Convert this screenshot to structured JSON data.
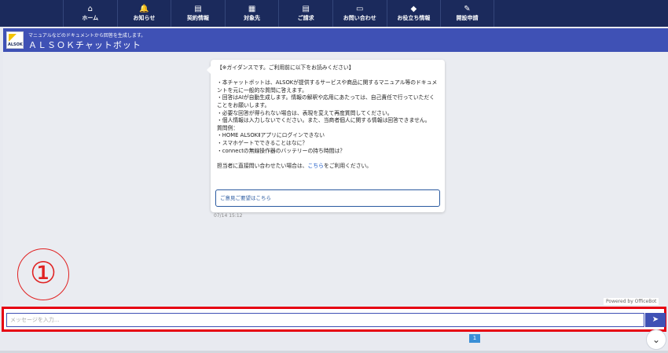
{
  "nav": {
    "items": [
      {
        "label": "ホーム",
        "icon": "⌂"
      },
      {
        "label": "お知らせ",
        "icon": "🔔"
      },
      {
        "label": "契約情報",
        "icon": "▤"
      },
      {
        "label": "対象先",
        "icon": "▦"
      },
      {
        "label": "ご請求",
        "icon": "▤"
      },
      {
        "label": "お問い合わせ",
        "icon": "▭"
      },
      {
        "label": "お役立ち情報",
        "icon": "◆"
      },
      {
        "label": "開設申請",
        "icon": "✎"
      }
    ]
  },
  "header": {
    "logo_text": "ALSOK",
    "subtitle": "マニュアルなどのドキュメントから回答を生成します。",
    "title": "ＡＬＳＯＫチャットボット"
  },
  "message": {
    "lines": [
      "【※ガイダンスです。ご利用前に以下をお読みください】",
      "",
      "・本チャットボットは、ALSOKが提供するサービスや商品に関するマニュアル等のドキュメントを元に一般的な質問に答えます。",
      "・回答はAIが自動生成します。情報の解釈や応用にあたっては、自己責任で行っていただくことをお願いします。",
      "・必要な回答が得られない場合は、表現を変えて再度質問してください。",
      "・個人情報は入力しないでください。また、当商者個人に関する情報は回答できません。",
      "質問例：",
      "・HOME ALSOKⅡアプリにログインできない",
      "・スマホゲートでできることはなに？",
      "・connectの無線操作器のバッテリーの持ち時間は？",
      ""
    ],
    "contact_prefix": "担当者に直接問い合わせたい場合は、",
    "contact_link": "こちら",
    "contact_suffix": "をご利用ください。",
    "button_label": "ご意見ご要望はこちら",
    "timestamp": "07/14 15:12"
  },
  "annotation": {
    "step_number": "①"
  },
  "powered_by": "Powered by OfficeBot",
  "input": {
    "placeholder": "メッセージを入力...",
    "value": ""
  },
  "send_icon": "➤",
  "pagination": {
    "current": "1"
  },
  "scroll_icon": "⌄"
}
